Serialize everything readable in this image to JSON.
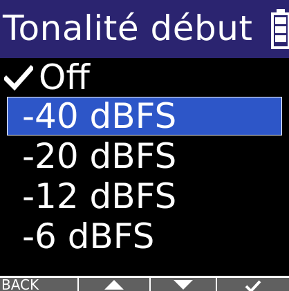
{
  "header": {
    "title": "Tonalité début",
    "battery_icon": "battery-icon"
  },
  "menu": {
    "items": [
      {
        "label": "Off",
        "checked": true,
        "selected": false
      },
      {
        "label": "-40 dBFS",
        "checked": false,
        "selected": true
      },
      {
        "label": "-20 dBFS",
        "checked": false,
        "selected": false
      },
      {
        "label": "-12 dBFS",
        "checked": false,
        "selected": false
      },
      {
        "label": "-6 dBFS",
        "checked": false,
        "selected": false
      }
    ]
  },
  "softkeys": {
    "back_label": "BACK",
    "up_icon": "triangle-up-icon",
    "down_icon": "triangle-down-icon",
    "confirm_icon": "check-icon"
  },
  "colors": {
    "title_bar": "#2b2470",
    "selection": "#2d56c8",
    "background": "#000000",
    "softkey": "#606060"
  }
}
